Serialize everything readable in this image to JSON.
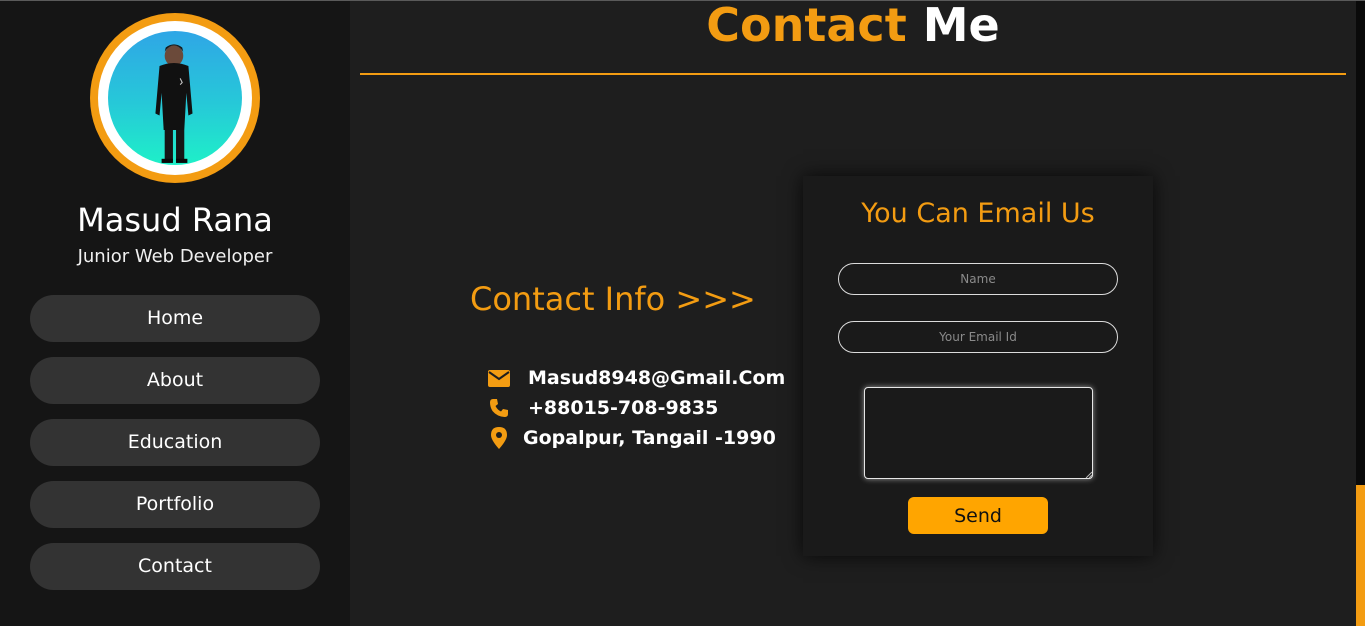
{
  "profile": {
    "name": "Masud Rana",
    "role": "Junior Web Developer",
    "avatar_icon": "profile-photo"
  },
  "nav": {
    "items": [
      {
        "label": "Home"
      },
      {
        "label": "About"
      },
      {
        "label": "Education"
      },
      {
        "label": "Portfolio"
      },
      {
        "label": "Contact"
      }
    ]
  },
  "page": {
    "title_accent": "Contact",
    "title_rest": "Me"
  },
  "contact_info": {
    "heading": "Contact Info >>>",
    "email": {
      "icon": "envelope-icon",
      "text": "Masud8948@Gmail.Com"
    },
    "phone": {
      "icon": "phone-icon",
      "text": "+88015-708-9835"
    },
    "address": {
      "icon": "map-pin-icon",
      "text": "Gopalpur, Tangail -1990"
    }
  },
  "form": {
    "heading": "You Can Email Us",
    "name_placeholder": "Name",
    "email_placeholder": "Your Email Id",
    "message_value": "",
    "send_label": "Send"
  },
  "colors": {
    "accent": "#f39c12",
    "button": "#ffa500",
    "background": "#1e1e1e",
    "sidebar": "#151515",
    "nav_item": "#333333"
  }
}
